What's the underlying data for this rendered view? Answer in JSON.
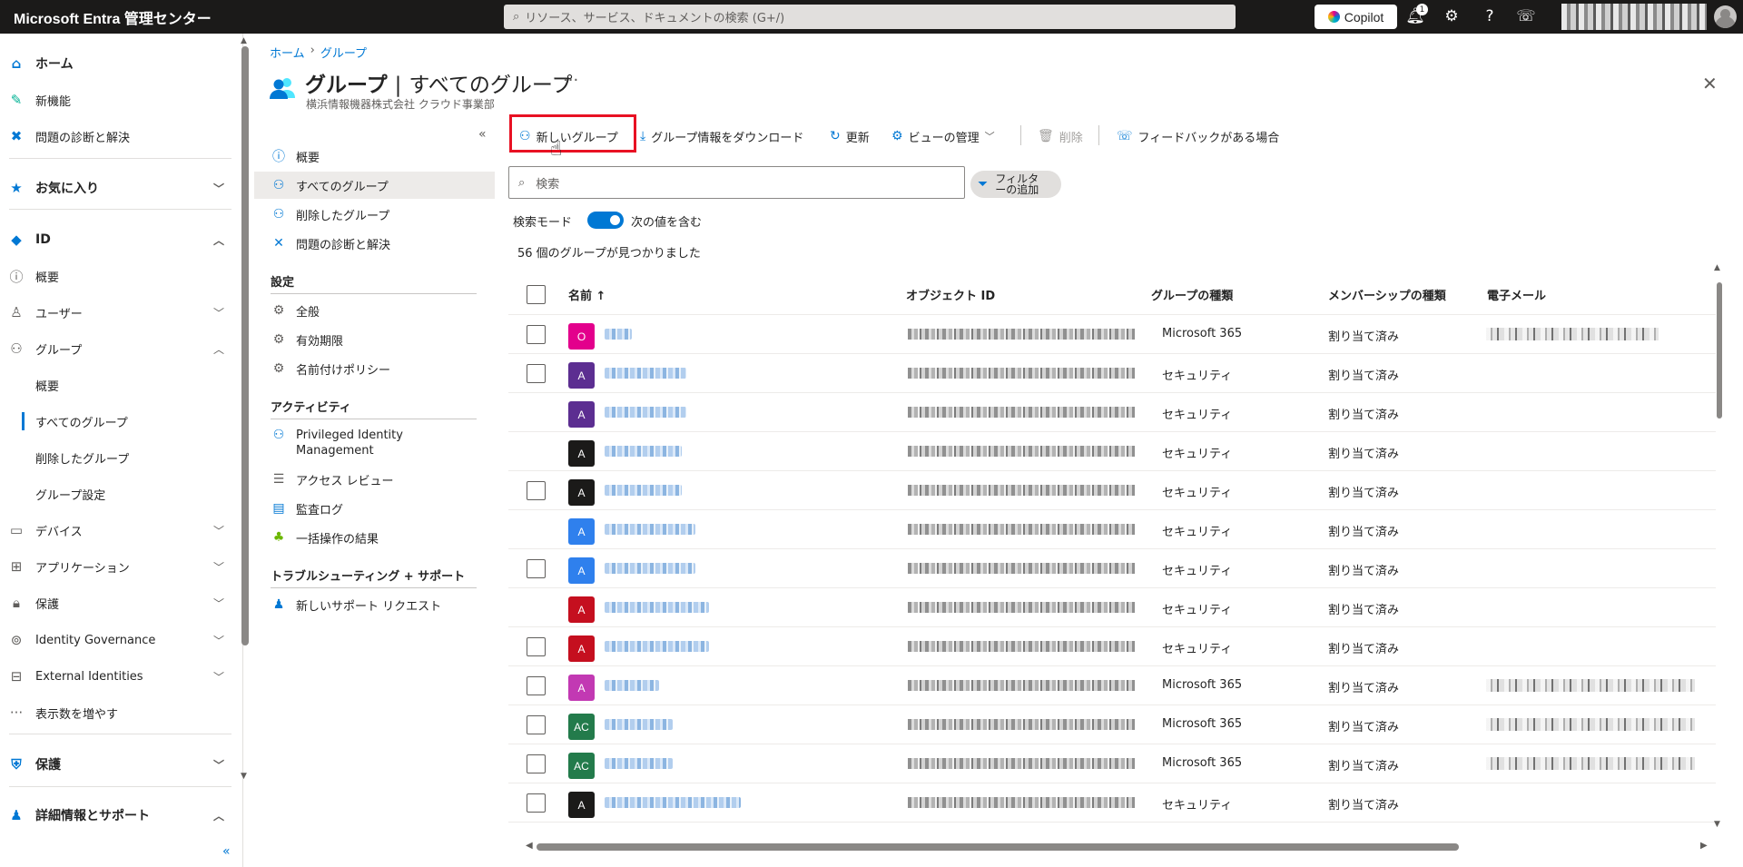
{
  "topbar": {
    "brand": "Microsoft Entra 管理センター",
    "search_placeholder": "リソース、サービス、ドキュメントの検索 (G+/)",
    "copilot_label": "Copilot",
    "notification_count": "1"
  },
  "nav": {
    "home": "ホーム",
    "whats_new": "新機能",
    "diagnose": "問題の診断と解決",
    "favorites": "お気に入り",
    "id": "ID",
    "overview": "概要",
    "users": "ユーザー",
    "groups": "グループ",
    "groups_overview": "概要",
    "all_groups": "すべてのグループ",
    "deleted_groups": "削除したグループ",
    "group_settings": "グループ設定",
    "devices": "デバイス",
    "applications": "アプリケーション",
    "protection": "保護",
    "identity_governance": "Identity Governance",
    "external_identities": "External Identities",
    "show_more": "表示数を増やす",
    "protection2": "保護",
    "learn_support": "詳細情報とサポート"
  },
  "breadcrumb": {
    "home": "ホーム",
    "groups": "グループ"
  },
  "page": {
    "title_main": "グループ",
    "title_sep": "|",
    "title_sub": "すべてのグループ",
    "more": "···",
    "subtitle": "横浜情報機器株式会社 クラウド事業部"
  },
  "subnav": {
    "overview": "概要",
    "all_groups": "すべてのグループ",
    "deleted_groups": "削除したグループ",
    "diagnose": "問題の診断と解決",
    "settings_heading": "設定",
    "general": "全般",
    "expiration": "有効期限",
    "naming_policy": "名前付けポリシー",
    "activity_heading": "アクティビティ",
    "pim_line1": "Privileged Identity",
    "pim_line2": "Management",
    "access_reviews": "アクセス レビュー",
    "audit_logs": "監査ログ",
    "bulk_results": "一括操作の結果",
    "troubleshoot_heading": "トラブルシューティング + サポート",
    "new_support": "新しいサポート リクエスト"
  },
  "toolbar": {
    "new_group": "新しいグループ",
    "download": "グループ情報をダウンロード",
    "refresh": "更新",
    "manage_view": "ビューの管理",
    "delete": "削除",
    "feedback": "フィードバックがある場合"
  },
  "search": {
    "placeholder": "検索"
  },
  "filter": {
    "line1": "フィルタ",
    "line2": "ーの追加"
  },
  "search_mode": {
    "label": "検索モード",
    "value": "次の値を含む"
  },
  "result_count": "56 個のグループが見つかりました",
  "table": {
    "headers": {
      "name": "名前 ↑",
      "object_id": "オブジェクト ID",
      "group_type": "グループの種類",
      "membership_type": "メンバーシップの種類",
      "email": "電子メール"
    },
    "rows": [
      {
        "initial": "O",
        "color": "#e3008c",
        "type": "Microsoft 365",
        "membership": "割り当て済み",
        "checkbox": true,
        "email": true,
        "name_w": 30
      },
      {
        "initial": "A",
        "color": "#5c2e91",
        "type": "セキュリティ",
        "membership": "割り当て済み",
        "checkbox": true,
        "email": false,
        "name_w": 90
      },
      {
        "initial": "A",
        "color": "#5c2e91",
        "type": "セキュリティ",
        "membership": "割り当て済み",
        "checkbox": false,
        "email": false,
        "name_w": 90
      },
      {
        "initial": "A",
        "color": "#1b1a19",
        "type": "セキュリティ",
        "membership": "割り当て済み",
        "checkbox": false,
        "email": false,
        "name_w": 85
      },
      {
        "initial": "A",
        "color": "#1b1a19",
        "type": "セキュリティ",
        "membership": "割り当て済み",
        "checkbox": true,
        "email": false,
        "name_w": 85
      },
      {
        "initial": "A",
        "color": "#2f80ed",
        "type": "セキュリティ",
        "membership": "割り当て済み",
        "checkbox": false,
        "email": false,
        "name_w": 100
      },
      {
        "initial": "A",
        "color": "#2f80ed",
        "type": "セキュリティ",
        "membership": "割り当て済み",
        "checkbox": true,
        "email": false,
        "name_w": 100
      },
      {
        "initial": "A",
        "color": "#c50f1f",
        "type": "セキュリティ",
        "membership": "割り当て済み",
        "checkbox": false,
        "email": false,
        "name_w": 115
      },
      {
        "initial": "A",
        "color": "#c50f1f",
        "type": "セキュリティ",
        "membership": "割り当て済み",
        "checkbox": true,
        "email": false,
        "name_w": 115
      },
      {
        "initial": "A",
        "color": "#c239b3",
        "type": "Microsoft 365",
        "membership": "割り当て済み",
        "checkbox": true,
        "email": true,
        "name_w": 60
      },
      {
        "initial": "AC",
        "color": "#237b4b",
        "type": "Microsoft 365",
        "membership": "割り当て済み",
        "checkbox": true,
        "email": true,
        "name_w": 75
      },
      {
        "initial": "AC",
        "color": "#237b4b",
        "type": "Microsoft 365",
        "membership": "割り当て済み",
        "checkbox": true,
        "email": true,
        "name_w": 75
      },
      {
        "initial": "A",
        "color": "#1b1a19",
        "type": "セキュリティ",
        "membership": "割り当て済み",
        "checkbox": true,
        "email": false,
        "name_w": 150
      }
    ]
  },
  "colors": {
    "accent": "#0078d4",
    "highlight": "#e81123",
    "topbar": "#1b1a19"
  }
}
